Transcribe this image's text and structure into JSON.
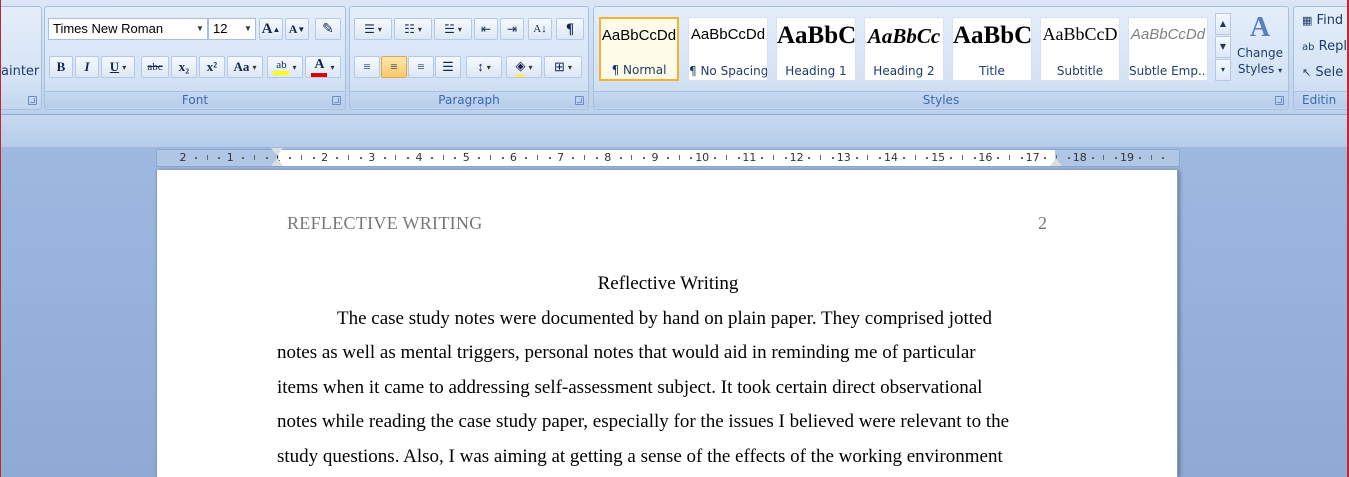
{
  "clipboard": {
    "format_painter_fragment": "ainter"
  },
  "font": {
    "group_label": "Font",
    "name": "Times New Roman",
    "size": "12",
    "grow_label": "A",
    "shrink_label": "A",
    "bold": "B",
    "italic": "I",
    "underline": "U",
    "strike": "abc",
    "subscript": "x₂",
    "superscript": "x²",
    "case": "Aa",
    "font_color_letter": "A"
  },
  "paragraph": {
    "group_label": "Paragraph",
    "show_marks": "¶"
  },
  "styles": {
    "group_label": "Styles",
    "items": [
      {
        "sample": "AaBbCcDd",
        "name": "¶ Normal"
      },
      {
        "sample": "AaBbCcDd",
        "name": "¶ No Spacing"
      },
      {
        "sample": "AaBbC",
        "name": "Heading 1"
      },
      {
        "sample": "AaBbCc",
        "name": "Heading 2"
      },
      {
        "sample": "AaBbC",
        "name": "Title"
      },
      {
        "sample": "AaBbCcD",
        "name": "Subtitle"
      },
      {
        "sample": "AaBbCcDd",
        "name": "Subtle Emp..."
      }
    ],
    "change_styles_line1": "Change",
    "change_styles_line2": "Styles"
  },
  "editing": {
    "group_label": "Editin",
    "find": "Find",
    "replace": "Repl",
    "select": "Sele"
  },
  "ruler": {
    "labels": [
      "2",
      "1",
      "1",
      "2",
      "3",
      "4",
      "5",
      "6",
      "7",
      "8",
      "9",
      "10",
      "11",
      "12",
      "13",
      "14",
      "15",
      "16",
      "17",
      "18",
      "19"
    ]
  },
  "document": {
    "running_head": "REFLECTIVE WRITING",
    "page_number": "2",
    "title": "Reflective Writing",
    "lines": [
      "The case study notes were documented by hand on plain paper. They comprised jotted",
      "notes as well as mental triggers, personal notes that would aid in reminding me of particular",
      "items when it came to addressing self-assessment subject. It took certain direct observational",
      "notes while reading the case study paper, especially for the issues I believed were relevant to the",
      "study questions. Also, I was aiming at getting a sense of the effects of the working environment"
    ]
  },
  "colors": {
    "highlight": "#ffff00",
    "font_color": "#e00000",
    "selected_style_border": "#f2b233"
  }
}
